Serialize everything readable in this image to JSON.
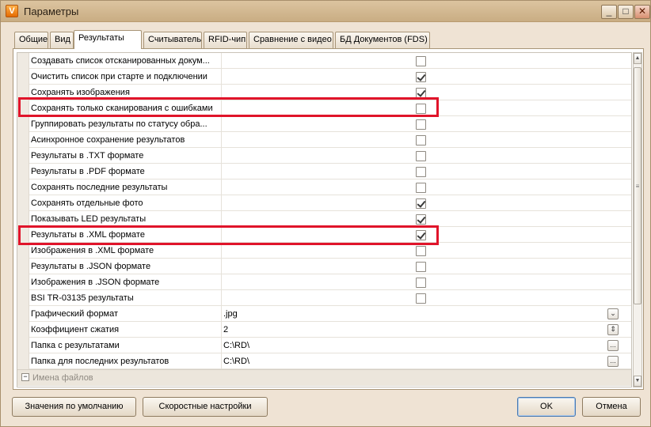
{
  "window": {
    "title": "Параметры",
    "icon": "app-logo-icon",
    "controls": {
      "minimize": "_",
      "maximize": "□",
      "close": "✕"
    }
  },
  "tabs": [
    {
      "label": "Общие"
    },
    {
      "label": "Вид"
    },
    {
      "label": "Результаты",
      "active": true
    },
    {
      "label": "Считыватель"
    },
    {
      "label": "RFID-чип"
    },
    {
      "label": "Сравнение с видео"
    },
    {
      "label": "БД Документов (FDS)"
    }
  ],
  "settings": [
    {
      "label": "Создавать список отсканированных докум...",
      "checked": false
    },
    {
      "label": "Очистить список при старте и подключении",
      "checked": true
    },
    {
      "label": "Сохранять изображения",
      "checked": true
    },
    {
      "label": "Сохранять только сканирования с ошибками",
      "checked": false,
      "highlighted": true
    },
    {
      "label": "Группировать результаты по статусу обра...",
      "checked": false
    },
    {
      "label": "Асинхронное сохранение результатов",
      "checked": false
    },
    {
      "label": "Результаты в .TXT формате",
      "checked": false
    },
    {
      "label": "Результаты в .PDF формате",
      "checked": false
    },
    {
      "label": "Сохранять последние результаты",
      "checked": false
    },
    {
      "label": "Сохранять отдельные фото",
      "checked": true
    },
    {
      "label": "Показывать LED результаты",
      "checked": true
    },
    {
      "label": "Результаты в .XML формате",
      "checked": true,
      "highlighted": true
    },
    {
      "label": "Изображения в .XML формате",
      "checked": false
    },
    {
      "label": "Результаты в .JSON формате",
      "checked": false
    },
    {
      "label": "Изображения в .JSON формате",
      "checked": false
    },
    {
      "label": "BSI TR-03135 результаты",
      "checked": false
    }
  ],
  "value_settings": [
    {
      "label": "Графический формат",
      "value": ".jpg",
      "control": "dropdown",
      "control_glyph": "⌄"
    },
    {
      "label": "Коэффициент сжатия",
      "value": "2",
      "control": "spinner",
      "control_glyph": "⇕"
    },
    {
      "label": "Папка с результатами",
      "value": "C:\\RD\\",
      "control": "browse",
      "control_glyph": "..."
    },
    {
      "label": "Папка для последних результатов",
      "value": "C:\\RD\\",
      "control": "browse",
      "control_glyph": "..."
    }
  ],
  "group": {
    "label": "Имена файлов",
    "toggle": "−"
  },
  "buttons": {
    "defaults": "Значения по умолчанию",
    "speed": "Скоростные настройки",
    "ok": "OK",
    "cancel": "Отмена"
  },
  "colors": {
    "highlight": "#e0142a",
    "accent": "#c9ad83"
  }
}
